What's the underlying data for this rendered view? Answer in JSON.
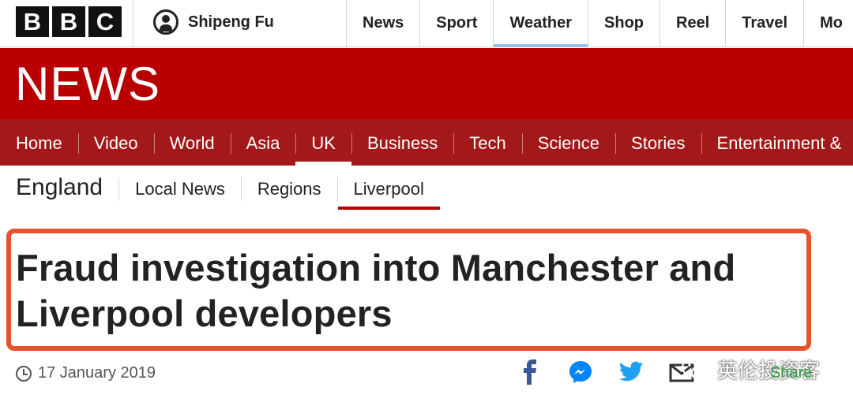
{
  "brand": {
    "letters": [
      "B",
      "B",
      "C"
    ],
    "news_logo": "NEWS"
  },
  "account": {
    "name": "Shipeng Fu"
  },
  "top_nav": [
    {
      "label": "News"
    },
    {
      "label": "Sport"
    },
    {
      "label": "Weather",
      "active": true
    },
    {
      "label": "Shop"
    },
    {
      "label": "Reel"
    },
    {
      "label": "Travel"
    },
    {
      "label": "Mo"
    }
  ],
  "section_nav": [
    {
      "label": "Home"
    },
    {
      "label": "Video"
    },
    {
      "label": "World"
    },
    {
      "label": "Asia"
    },
    {
      "label": "UK",
      "active": true
    },
    {
      "label": "Business"
    },
    {
      "label": "Tech"
    },
    {
      "label": "Science"
    },
    {
      "label": "Stories"
    },
    {
      "label": "Entertainment &"
    }
  ],
  "sub_nav": {
    "title": "England",
    "items": [
      {
        "label": "Local News"
      },
      {
        "label": "Regions"
      },
      {
        "label": "Liverpool",
        "active": true
      }
    ]
  },
  "article": {
    "headline_line1": "Fraud investigation into Manchester and",
    "headline_line2": "Liverpool developers",
    "date": "17 January 2019"
  },
  "share": {
    "icons": [
      "facebook-icon",
      "messenger-icon",
      "twitter-icon",
      "email-icon"
    ],
    "label": "Share"
  },
  "watermark": {
    "text": "英伦投资客"
  },
  "colors": {
    "news_red": "#b80000",
    "section_red": "#a31818",
    "highlight_box": "#e5522b",
    "weather_underline": "#93c2e6",
    "facebook": "#3b5998",
    "messenger": "#0084ff",
    "twitter": "#1da1f2",
    "share_green": "#2b9a39"
  }
}
